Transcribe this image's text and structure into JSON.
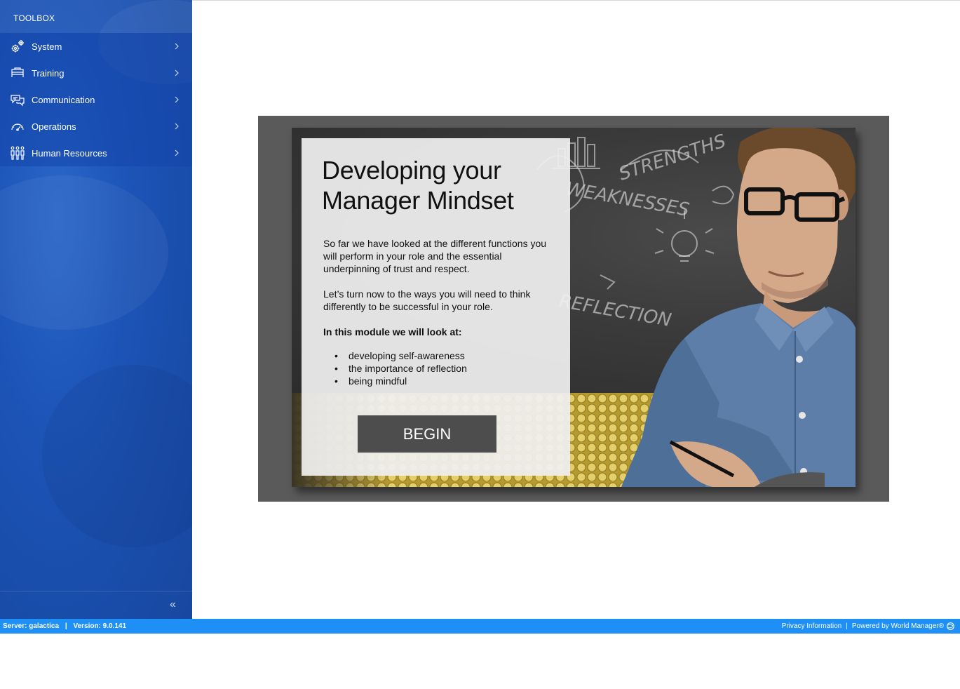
{
  "sidebar": {
    "title": "TOOLBOX",
    "items": [
      {
        "label": "System",
        "icon": "gears-icon"
      },
      {
        "label": "Training",
        "icon": "training-desk-icon"
      },
      {
        "label": "Communication",
        "icon": "chat-bubbles-icon"
      },
      {
        "label": "Operations",
        "icon": "speedometer-icon"
      },
      {
        "label": "Human Resources",
        "icon": "people-icon"
      }
    ],
    "collapse_glyph": "«"
  },
  "slide": {
    "title": "Developing your Manager Mindset",
    "paragraph1": "So far we have looked at the different functions you will perform in your role and the essential underpinning of trust and respect.",
    "paragraph2": "Let’s turn now to the ways you will need to think differently to be successful in your role.",
    "module_heading": "In this module we will look at:",
    "bullets": [
      "developing self-awareness",
      "the importance of reflection",
      "being mindful"
    ],
    "begin_label": "BEGIN",
    "chalk_words": [
      "STRENGTHS",
      "WEAKNESSES",
      "REFLECTION"
    ]
  },
  "footer": {
    "server": "Server: galactica",
    "separator": "|",
    "version": "Version: 9.0.141",
    "privacy": "Privacy Information",
    "powered": "Powered by World Manager®"
  },
  "colors": {
    "sidebar_blue": "#1d55b8",
    "footer_blue": "#1e90f5",
    "begin_button": "#4d4d4d",
    "stage_gray": "#5a5a5a"
  }
}
